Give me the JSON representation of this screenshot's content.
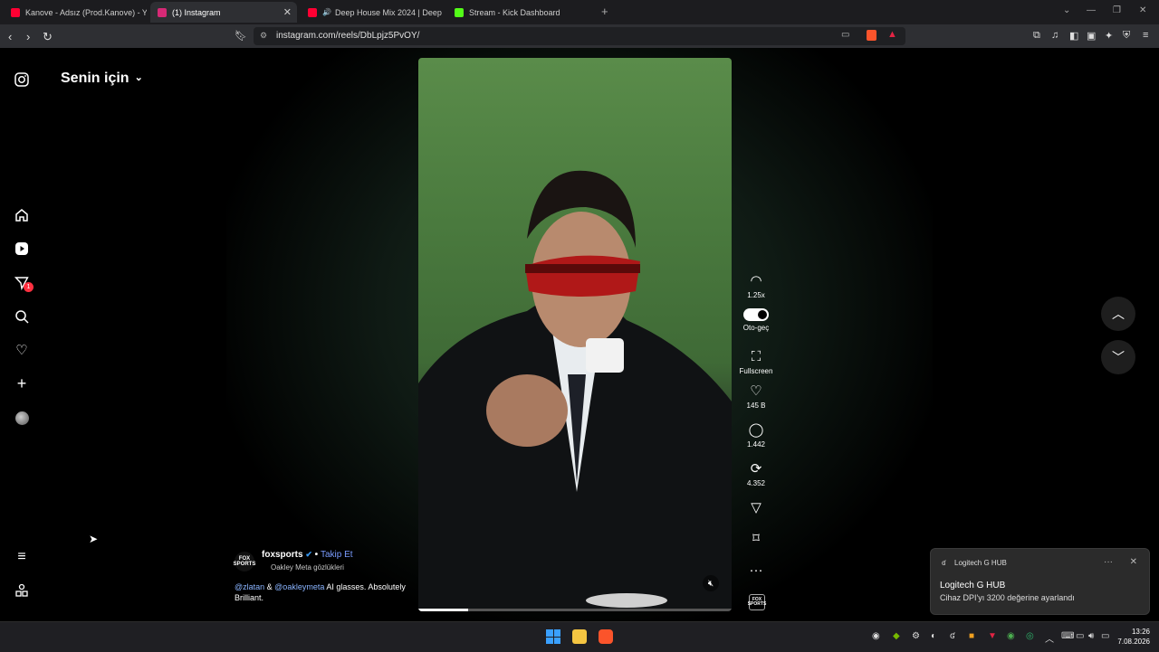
{
  "browser": {
    "tabs": [
      {
        "title": "Kanove - Adsız (Prod.Kanove) - YouTube",
        "fav_color": "#ff0033",
        "active": false
      },
      {
        "title": "(1) Instagram",
        "fav_color": "#d62976",
        "active": true
      },
      {
        "title": "Deep House Mix 2024 | Deep House",
        "fav_color": "#ff0033",
        "active": false
      },
      {
        "title": "Stream - Kick Dashboard",
        "fav_color": "#53fc18",
        "active": false
      }
    ],
    "url": "instagram.com/reels/DbLpjz5PvOY/"
  },
  "sidebar": {
    "feed_title": "Senin için",
    "notification_count": "1"
  },
  "reel": {
    "progress_fraction": 0.16,
    "actions": {
      "speed": "1.25x",
      "autoplay": "Oto-geç",
      "fullscreen": "Fullscreen",
      "likes": "145 B",
      "comments": "1.442",
      "reposts": "4.352"
    },
    "author": {
      "logo_text": "FOX SPORTS",
      "username": "foxsports",
      "follow": "Takip Et",
      "subtitle": "Oakley Meta gözlükleri"
    },
    "caption": {
      "mention1": "@zlatan",
      "amp": " & ",
      "mention2": "@oakleymeta",
      "rest": " AI glasses. Absolutely Brilliant."
    }
  },
  "toast": {
    "app_name": "Logitech G HUB",
    "heading": "Logitech G HUB",
    "body": "Cihaz DPI'yı 3200 değerine ayarlandı"
  },
  "taskbar": {
    "time": "13:26",
    "date": "7.08.2026"
  }
}
